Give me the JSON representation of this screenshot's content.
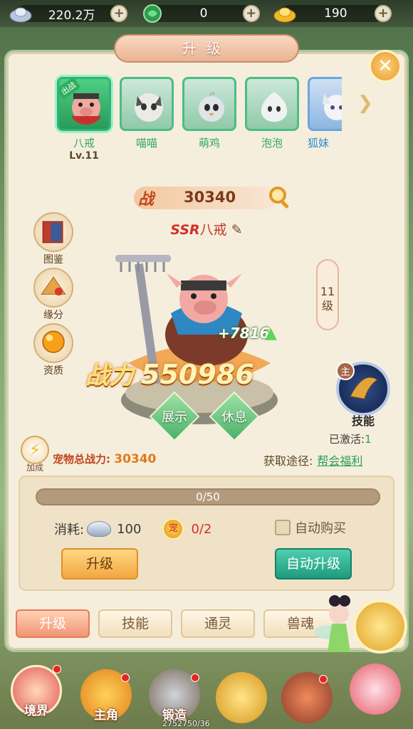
{
  "resources": [
    {
      "icon": "silver-ingot-icon",
      "value": "220.2万"
    },
    {
      "icon": "jade-icon",
      "value": "0"
    },
    {
      "icon": "gold-ingot-icon",
      "value": "190"
    }
  ],
  "panel": {
    "title": "升级"
  },
  "pets": [
    {
      "name": "八戒",
      "level": "Lv.11",
      "tag": "出战",
      "selected": true
    },
    {
      "name": "喵喵"
    },
    {
      "name": "萌鸡"
    },
    {
      "name": "泡泡"
    },
    {
      "name": "狐妹"
    }
  ],
  "battle": {
    "label": "战",
    "value": "30340"
  },
  "pet_title": {
    "rarity": "SSR",
    "name": "八戒"
  },
  "side_buttons": {
    "atlas": "图鉴",
    "fate": "缘分",
    "aptitude": "资质"
  },
  "level_badge": {
    "num": "11",
    "unit": "级"
  },
  "power_gain": "+7816",
  "combat_power": {
    "label": "战力",
    "value": "550986"
  },
  "actions": {
    "show": "展示",
    "rest": "休息"
  },
  "skill": {
    "main_tag": "主",
    "label": "技能",
    "active_label": "已激活:",
    "active_count": "1"
  },
  "bonus": {
    "label": "加成"
  },
  "total_power": {
    "label": "宠物总战力:",
    "value": "30340"
  },
  "source": {
    "label": "获取途径:",
    "link": "帮会福利"
  },
  "upgrade": {
    "progress_text": "0/50",
    "progress_fraction": 0,
    "cost_label": "消耗:",
    "silver_cost": "100",
    "token_label": "宠",
    "token_cost": "0/2",
    "auto_buy": "自动购买",
    "upgrade_button": "升级",
    "auto_upgrade_button": "自动升级"
  },
  "tabs": [
    "升级",
    "技能",
    "通灵",
    "兽魂"
  ],
  "nav": [
    {
      "label": "境界"
    },
    {
      "label": "主角"
    },
    {
      "label": "锻造"
    }
  ],
  "exp_text": "2752750/36"
}
